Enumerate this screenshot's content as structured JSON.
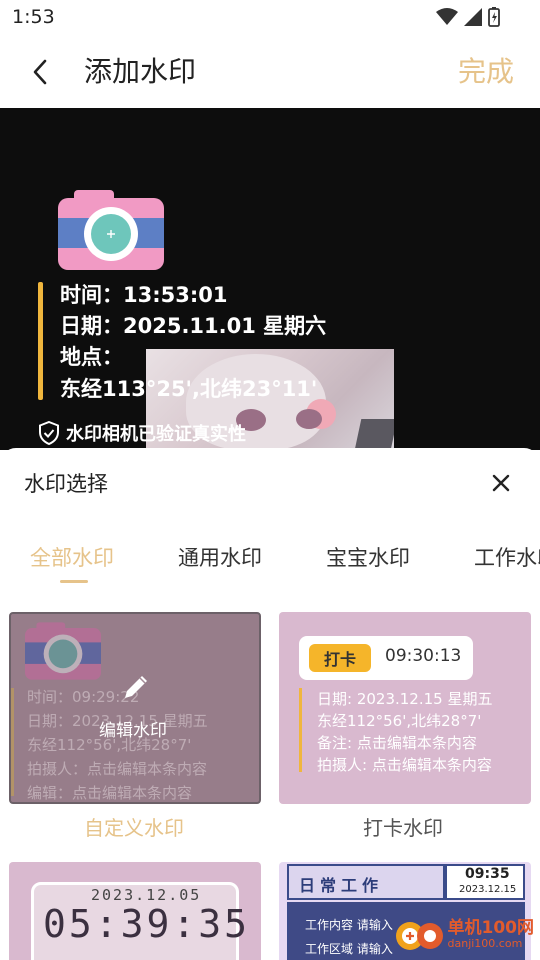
{
  "status_bar": {
    "time": "1:53"
  },
  "header": {
    "title": "添加水印",
    "done_label": "完成"
  },
  "preview": {
    "lines": {
      "time": "时间：13:53:01",
      "date": "日期：2025.11.01 星期六",
      "location": "地点：",
      "coords": "东经113°25',北纬23°11'"
    },
    "security_text": "水印相机已验证真实性"
  },
  "sheet": {
    "title": "水印选择",
    "tabs": [
      {
        "label": "全部水印",
        "active": true
      },
      {
        "label": "通用水印"
      },
      {
        "label": "宝宝水印"
      },
      {
        "label": "工作水印"
      }
    ],
    "cards": [
      {
        "label": "自定义水印",
        "overlay": "编辑水印",
        "lines": [
          "时间：09:29:22",
          "日期：2023.12.15 星期五",
          "东经112°56',北纬28°7'",
          "拍摄人：点击编辑本条内容",
          "编辑：点击编辑本条内容"
        ]
      },
      {
        "label": "打卡水印",
        "badge": "打卡",
        "time": "09:30:13",
        "lines": [
          "日期: 2023.12.15 星期五",
          "东经112°56',北纬28°7'",
          "备注: 点击编辑本条内容",
          "拍摄人: 点击编辑本条内容"
        ]
      },
      {
        "date": "2023.12.05",
        "clock": "05:39:35"
      },
      {
        "title": "日常工作",
        "time": "09:35",
        "date": "2023.12.15",
        "rows": [
          "工作内容  请输入",
          "工作区域  请输入"
        ]
      }
    ]
  },
  "site_badge": {
    "main": "单机100网",
    "sub": "danji100.com"
  },
  "colors": {
    "accent": "#e6c38a",
    "marker": "#f0b63d",
    "preview_bg": "#0d0d0d"
  }
}
